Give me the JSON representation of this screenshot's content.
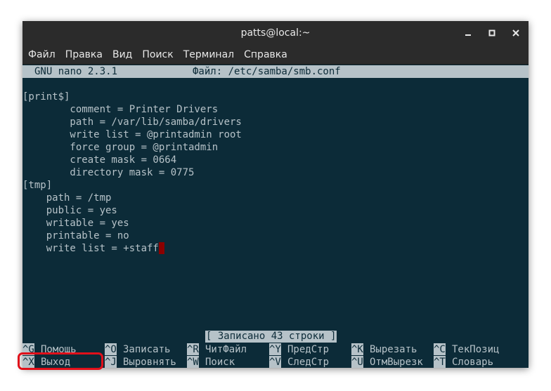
{
  "window": {
    "title": "patts@local:~",
    "controls": {
      "minimize": "–",
      "maximize": "□",
      "close": "✕"
    }
  },
  "menubar": {
    "items": [
      "Файл",
      "Правка",
      "Вид",
      "Поиск",
      "Терминал",
      "Справка"
    ]
  },
  "nano": {
    "version": "GNU nano 2.3.1",
    "file": "Файл: /etc/samba/smb.conf",
    "lines": [
      "",
      "[print$]",
      "        comment = Printer Drivers",
      "        path = /var/lib/samba/drivers",
      "        write list = @printadmin root",
      "        force group = @printadmin",
      "        create mask = 0664",
      "        directory mask = 0775",
      "[tmp]",
      "    path = /tmp",
      "    public = yes",
      "    writable = yes",
      "    printable = no",
      "    write list = +staff"
    ],
    "status": "[ Записано 43 строки ]",
    "shortcuts_row1": [
      {
        "key": "^G",
        "label": "Помощь"
      },
      {
        "key": "^O",
        "label": "Записать"
      },
      {
        "key": "^R",
        "label": "ЧитФайл"
      },
      {
        "key": "^Y",
        "label": "ПредСтр"
      },
      {
        "key": "^K",
        "label": "Вырезать"
      },
      {
        "key": "^C",
        "label": "ТекПозиц"
      }
    ],
    "shortcuts_row2": [
      {
        "key": "^X",
        "label": "Выход"
      },
      {
        "key": "^J",
        "label": "Выровнять"
      },
      {
        "key": "^W",
        "label": "Поиск"
      },
      {
        "key": "^V",
        "label": "СледСтр"
      },
      {
        "key": "^U",
        "label": "ОтмВырезк"
      },
      {
        "key": "^T",
        "label": "Словарь"
      }
    ]
  },
  "colors": {
    "terminal_bg": "#0c2b38",
    "terminal_fg": "#b6c2c8",
    "cursor": "#8b0000",
    "highlight": "#e0101a"
  }
}
